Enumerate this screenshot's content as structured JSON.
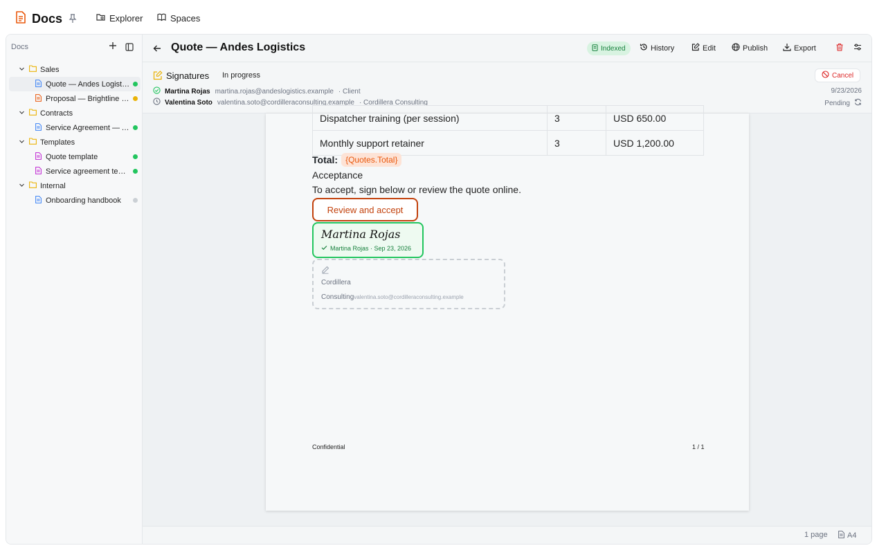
{
  "app": {
    "title": "Docs"
  },
  "topnav": [
    {
      "label": "Explorer"
    },
    {
      "label": "Spaces"
    }
  ],
  "sidebar": {
    "header": "Docs",
    "tree": [
      {
        "label": "Sales"
      },
      {
        "label": "Quote — Andes Logistics"
      },
      {
        "label": "Proposal — Brightline Freight"
      },
      {
        "label": "Contracts"
      },
      {
        "label": "Service Agreement — Andes"
      },
      {
        "label": "Templates"
      },
      {
        "label": "Quote template"
      },
      {
        "label": "Service agreement template"
      },
      {
        "label": "Internal"
      },
      {
        "label": "Onboarding handbook"
      }
    ]
  },
  "header": {
    "title": "Quote — Andes Logistics",
    "badge": "Indexed",
    "actions": [
      "History",
      "Edit",
      "Publish",
      "Export"
    ]
  },
  "signatures": {
    "title": "Signatures",
    "status": "In progress",
    "cancel_label": "Cancel",
    "signers": [
      {
        "name": "Martina Rojas",
        "email": "martina.rojas@andeslogistics.example",
        "role": "· Client",
        "state": "9/23/2026"
      },
      {
        "name": "Valentina Soto",
        "email": "valentina.soto@cordilleraconsulting.example",
        "role": "· Cordillera Consulting",
        "state": "Pending"
      }
    ]
  },
  "document": {
    "rows": [
      {
        "item": "Dispatcher training (per session)",
        "qty": "3",
        "price": "USD 650.00"
      },
      {
        "item": "Monthly support retainer",
        "qty": "3",
        "price": "USD 1,200.00"
      }
    ],
    "total_label": "Total:",
    "total_var": "{Quotes.Total}",
    "acceptance_heading": "Acceptance",
    "acceptance_text": "To accept, sign below or review the quote online.",
    "review_button": "Review and accept",
    "signed": {
      "name": "Martina Rojas",
      "meta": "Martina Rojas · Sep 23, 2026"
    },
    "pending": {
      "line1": "Cordillera",
      "line2": "Consulting",
      "email": "valentina.soto@cordilleraconsulting.example"
    },
    "footer_left": "Confidential",
    "footer_right": "1 / 1"
  },
  "statusbar": {
    "pages": "1 page",
    "paper": "A4"
  },
  "colors": {
    "accent": "#c2410c",
    "success": "#22c55e",
    "pending_dot": "#eab308",
    "danger": "#dc2626"
  }
}
